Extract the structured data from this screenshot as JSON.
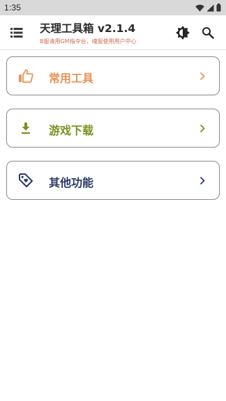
{
  "status_bar": {
    "time": "1:35",
    "icons": [
      "wifi-icon",
      "signal-icon",
      "battery-icon"
    ]
  },
  "app_bar": {
    "title": "天理工具箱 v2.1.4",
    "subtitle": "B服请用GM指令台，魂服使用用户中心",
    "icons": [
      "menu-list-icon",
      "brightness-theme-icon",
      "search-icon"
    ]
  },
  "cards": [
    {
      "label": "常用工具",
      "icon": "thumbs-up-icon",
      "color": "#e8945a"
    },
    {
      "label": "游戏下载",
      "icon": "download-icon",
      "color": "#76921e"
    },
    {
      "label": "其他功能",
      "icon": "tag-icon",
      "color": "#2b3a6a"
    }
  ],
  "colors": {
    "status_bar_bg": "#d9d9d9",
    "subtitle": "#d06a50",
    "card_border": "#8a8a8a"
  }
}
